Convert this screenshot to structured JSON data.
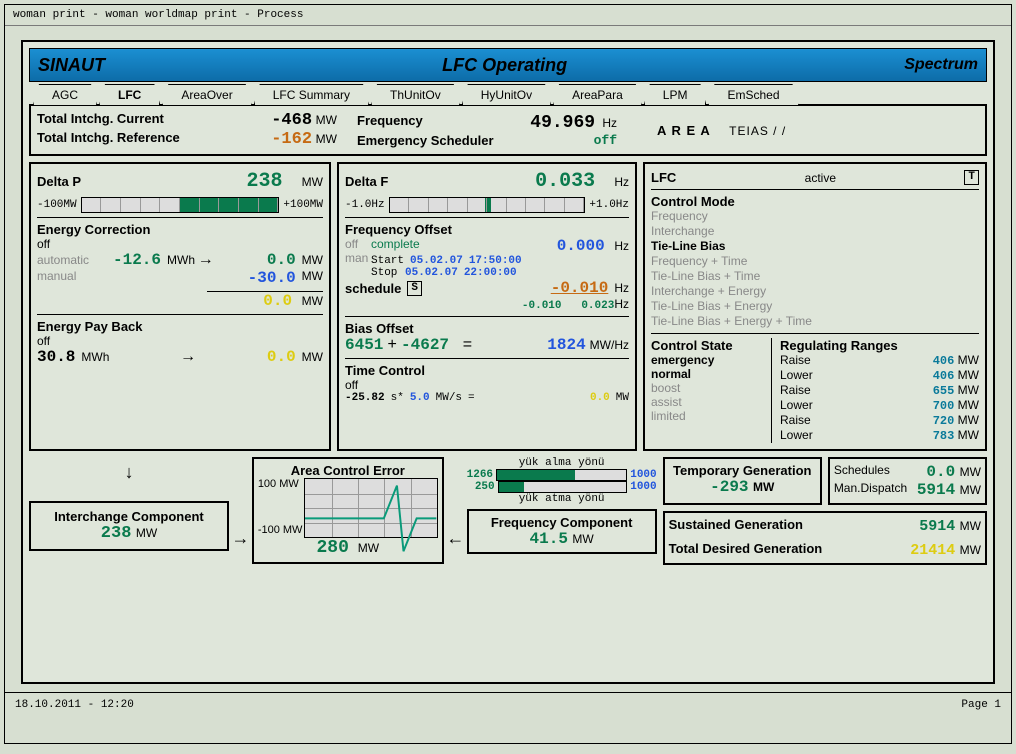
{
  "window_title": "woman print - woman worldmap print - Process",
  "footer": {
    "date": "18.10.2011 - 12:20",
    "page": "Page 1"
  },
  "header": {
    "left": "SINAUT",
    "center": "LFC Operating",
    "right": "Spectrum"
  },
  "tabs": [
    "AGC",
    "LFC",
    "AreaOver",
    "LFC Summary",
    "ThUnitOv",
    "HyUnitOv",
    "AreaPara",
    "LPM",
    "EmSched"
  ],
  "active_tab": "LFC",
  "top": {
    "tic_label": "Total Intchg. Current",
    "tic_val": "-468",
    "tic_unit": "MW",
    "tir_label": "Total Intchg. Reference",
    "tir_val": "-162",
    "tir_unit": "MW",
    "freq_label": "Frequency",
    "freq_val": "49.969",
    "freq_unit": "Hz",
    "es_label": "Emergency Scheduler",
    "es_val": "off",
    "area_label": "A R E A",
    "area_val": "TEIAS  /        /"
  },
  "deltaP": {
    "title": "Delta P",
    "val": "238",
    "unit": "MW",
    "min": "-100MW",
    "max": "+100MW",
    "ec_title": "Energy Correction",
    "ec_state": "off",
    "auto_label": "automatic",
    "auto_val": "-12.6",
    "auto_unit": "MWh",
    "auto_mw": "0.0",
    "auto_mw_unit": "MW",
    "man_label": "manual",
    "man_val": "-30.0",
    "man_unit": "MW",
    "sum_val": "0.0",
    "sum_unit": "MW",
    "pb_title": "Energy Pay Back",
    "pb_state": "off",
    "pb_val": "30.8",
    "pb_unit": "MWh",
    "pb_mw": "0.0",
    "pb_mw_unit": "MW"
  },
  "deltaF": {
    "title": "Delta F",
    "val": "0.033",
    "unit": "Hz",
    "min": "-1.0Hz",
    "max": "+1.0Hz",
    "fo_title": "Frequency Offset",
    "fo_off": "off",
    "fo_man": "man",
    "fo_complete": "complete",
    "fo_val": "0.000",
    "fo_unit": "Hz",
    "start": "Start",
    "start_date": "05.02.07",
    "start_time": "17:50:00",
    "stop": "Stop",
    "stop_date": "05.02.07",
    "stop_time": "22:00:00",
    "sch": "schedule",
    "sch_s": "S",
    "sch_v1": "-0.010",
    "sch_u1": "Hz",
    "sch_v2": "-0.010",
    "sch_v3": "0.023",
    "sch_u3": "Hz",
    "bo_title": "Bias Offset",
    "bo_a": "6451",
    "bo_b": "-4627",
    "bo_eq": "1824",
    "bo_unit": "MW/Hz",
    "tc_title": "Time Control",
    "tc_state": "off",
    "tc_s": "-25.82",
    "tc_s_unit": "s*",
    "tc_rate": "5.0",
    "tc_rate_unit": "MW/s",
    "tc_mw": "0.0",
    "tc_mw_unit": "MW"
  },
  "lfc": {
    "title": "LFC",
    "state": "active",
    "T": "T",
    "cm_title": "Control Mode",
    "modes": [
      "Frequency",
      "Interchange",
      "Tie-Line Bias",
      "Frequency   + Time",
      "Tie-Line Bias + Time",
      "Interchange  + Energy",
      "Tie-Line Bias + Energy",
      "Tie-Line Bias + Energy + Time"
    ],
    "cs_title": "Control State",
    "states": [
      "emergency",
      "normal",
      "boost",
      "assist",
      "limited"
    ],
    "rr_title": "Regulating Ranges",
    "rr": [
      {
        "l": "Raise",
        "v": "406",
        "u": "MW"
      },
      {
        "l": "Lower",
        "v": "406",
        "u": "MW"
      },
      {
        "l": "Raise",
        "v": "655",
        "u": "MW"
      },
      {
        "l": "Lower",
        "v": "700",
        "u": "MW"
      },
      {
        "l": "Raise",
        "v": "720",
        "u": "MW"
      },
      {
        "l": "Lower",
        "v": "783",
        "u": "MW"
      }
    ]
  },
  "bottom": {
    "ic_title": "Interchange Component",
    "ic_val": "238",
    "ic_unit": "MW",
    "ace_title": "Area Control Error",
    "ace_top": "100 MW",
    "ace_bot": "-100 MW",
    "ace_val": "280",
    "ace_unit": "MW",
    "ya_title": "yük alma yönü",
    "yt_title": "yük atma yönü",
    "ya_left": "1266",
    "ya_right": "1000",
    "yt_left": "250",
    "yt_right": "1000",
    "fc_title": "Frequency Component",
    "fc_val": "41.5",
    "fc_unit": "MW",
    "tg_title": "Temporary Generation",
    "tg_val": "-293",
    "tg_unit": "MW",
    "sch_title": "Schedules",
    "sch_val": "0.0",
    "sch_unit": "MW",
    "md_title": "Man.Dispatch",
    "md_val": "5914",
    "md_unit": "MW",
    "sg_title": "Sustained Generation",
    "sg_val": "5914",
    "sg_unit": "MW",
    "tdg_title": "Total Desired Generation",
    "tdg_val": "21414",
    "tdg_unit": "MW"
  }
}
